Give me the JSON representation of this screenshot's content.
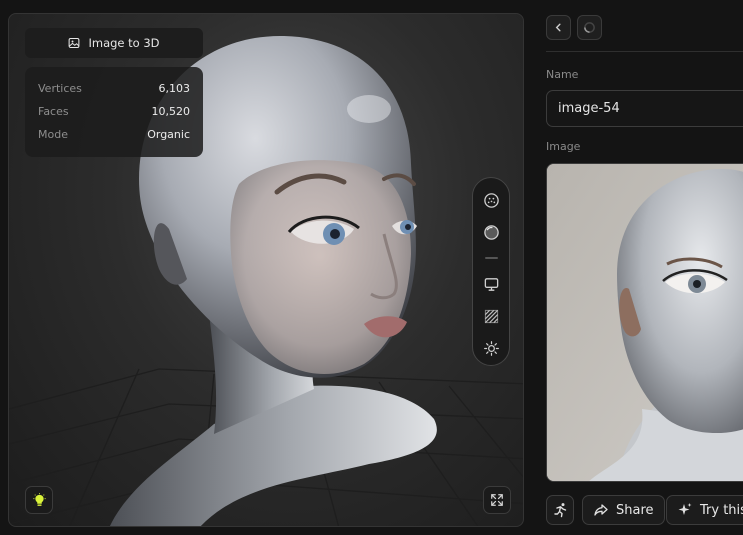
{
  "viewer": {
    "mode_label": "Image to 3D",
    "mode_icon": "image-icon",
    "stats": [
      {
        "label": "Vertices",
        "value": "6,103"
      },
      {
        "label": "Faces",
        "value": "10,520"
      },
      {
        "label": "Mode",
        "value": "Organic"
      }
    ],
    "toolbar": [
      "texture-sphere-icon",
      "solid-sphere-icon",
      "divider",
      "monitor-icon",
      "wireframe-icon",
      "sun-icon"
    ],
    "light_button_icon": "lightbulb-icon",
    "light_button_color": "#d9f23a",
    "expand_button_icon": "expand-icon"
  },
  "details": {
    "name_label": "Name",
    "name_value": "image-54",
    "image_label": "Image",
    "actions": {
      "share_label": "Share",
      "try_label": "Try this"
    }
  }
}
